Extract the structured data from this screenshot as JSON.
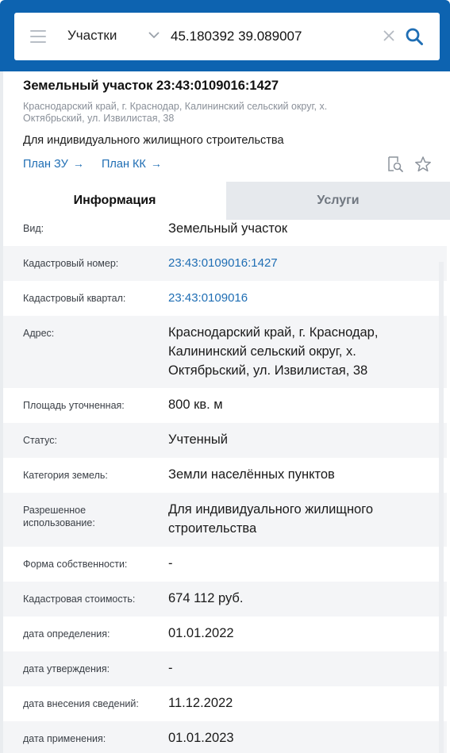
{
  "search": {
    "type_label": "Участки",
    "query": "45.180392 39.089007"
  },
  "object": {
    "title": "Земельный участок 23:43:0109016:1427",
    "address": "Краснодарский край, г. Краснодар, Калининский сельский округ, х. Октябрьский, ул. Извилистая, 38",
    "purpose": "Для индивидуального жилищного строительства",
    "plan_zu": "План ЗУ",
    "plan_kk": "План КК",
    "arrow": "→"
  },
  "tabs": {
    "info": "Информация",
    "services": "Услуги"
  },
  "rows": [
    {
      "label": "Вид:",
      "value": "Земельный участок"
    },
    {
      "label": "Кадастровый номер:",
      "value": "23:43:0109016:1427"
    },
    {
      "label": "Кадастровый квартал:",
      "value": "23:43:0109016"
    },
    {
      "label": "Адрес:",
      "value": "Краснодарский край, г. Краснодар, Калининский сельский округ, х. Октябрьский, ул. Извилистая, 38"
    },
    {
      "label": "Площадь уточненная:",
      "value": "800 кв. м"
    },
    {
      "label": "Статус:",
      "value": "Учтенный"
    },
    {
      "label": "Категория земель:",
      "value": "Земли населённых пунктов"
    },
    {
      "label": "Разрешенное использование:",
      "value": "Для индивидуального жилищного строительства"
    },
    {
      "label": "Форма собственности:",
      "value": "-"
    },
    {
      "label": "Кадастровая стоимость:",
      "value": "674 112 руб."
    },
    {
      "label": "дата определения:",
      "value": "01.01.2022"
    },
    {
      "label": "дата утверждения:",
      "value": "-"
    },
    {
      "label": "дата внесения сведений:",
      "value": "11.12.2022"
    },
    {
      "label": "дата применения:",
      "value": "01.01.2023"
    }
  ],
  "colors": {
    "brand_blue": "#0d63b0",
    "link_blue": "#1f6eb4",
    "alt_row": "#f4f5f7"
  }
}
